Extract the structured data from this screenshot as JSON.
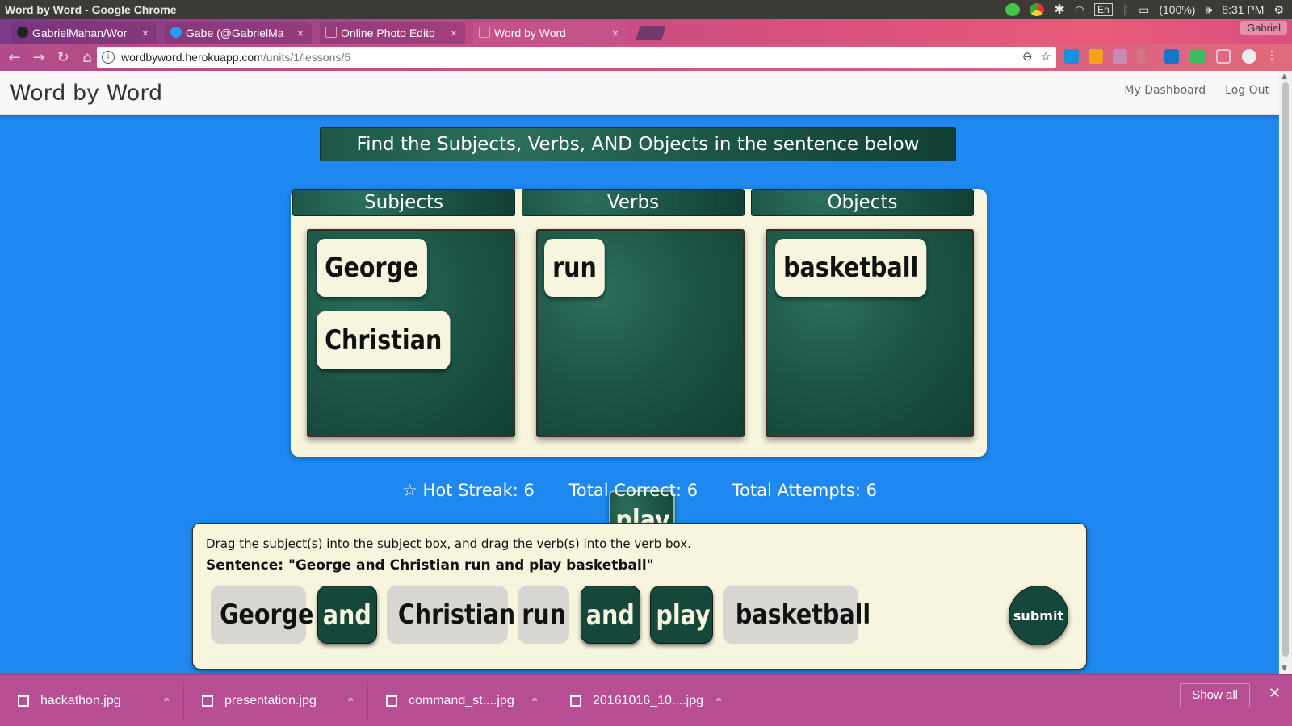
{
  "os": {
    "window_title": "Word by Word - Google Chrome",
    "battery": "(100%)",
    "time": "8:31 PM",
    "lang": "En"
  },
  "browser": {
    "tabs": [
      {
        "label": "GabrielMahan/Wor",
        "close": "×"
      },
      {
        "label": "Gabe (@GabrielMa",
        "close": "×"
      },
      {
        "label": "Online Photo Edito",
        "close": "×"
      },
      {
        "label": "Word by Word",
        "close": "×"
      }
    ],
    "profile": "Gabriel",
    "url_host": "wordbyword.herokuapp.com",
    "url_path": "/units/1/lessons/5"
  },
  "app": {
    "brand": "Word by Word",
    "nav": {
      "dashboard": "My Dashboard",
      "logout": "Log Out"
    },
    "instruction": "Find the Subjects, Verbs, AND Objects in the sentence below",
    "columns": {
      "subjects": {
        "title": "Subjects",
        "words": [
          "George",
          "Christian"
        ]
      },
      "verbs": {
        "title": "Verbs",
        "words": [
          "run"
        ]
      },
      "objects": {
        "title": "Objects",
        "words": [
          "basketball"
        ]
      }
    },
    "dragging_word": "play",
    "stats": {
      "hot_streak": "☆ Hot Streak: 6",
      "total_correct": "Total Correct: 6",
      "total_attempts": "Total Attempts: 6"
    },
    "panel": {
      "help": "Drag the subject(s) into the subject box, and drag the verb(s) into the verb box.",
      "sentence": "Sentence: \"George and Christian run and play basketball\"",
      "tiles": [
        "George",
        "and",
        "Christian",
        "run",
        "and",
        "play",
        "basketball"
      ],
      "submit": "submit"
    }
  },
  "downloads": {
    "items": [
      "hackathon.jpg",
      "presentation.jpg",
      "command_st....jpg",
      "20161016_10....jpg"
    ],
    "show_all": "Show all",
    "close": "✕"
  }
}
